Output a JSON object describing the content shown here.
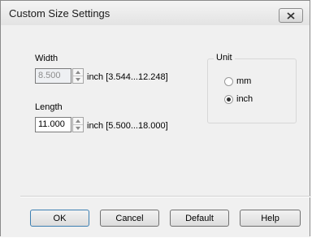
{
  "window": {
    "title": "Custom Size Settings"
  },
  "width": {
    "label": "Width",
    "value": "8.500",
    "range": "inch [3.544...12.248]"
  },
  "length": {
    "label": "Length",
    "value": "11.000",
    "range": "inch [5.500...18.000]"
  },
  "unit": {
    "title": "Unit",
    "options": [
      "mm",
      "inch"
    ],
    "selected": "inch"
  },
  "buttons": {
    "ok": "OK",
    "cancel": "Cancel",
    "default": "Default",
    "help": "Help"
  },
  "icons": {
    "close": "close-icon",
    "spin_up": "spin-up-icon",
    "spin_down": "spin-down-icon"
  }
}
